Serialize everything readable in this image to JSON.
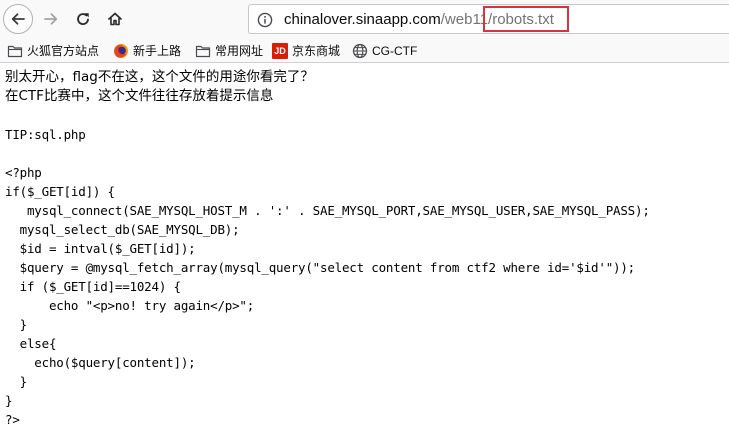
{
  "browser": {
    "url": {
      "domain": "chinalover.sinaapp.com",
      "path_prefix": "/web11",
      "path_highlight": "/robots.txt"
    },
    "icons": [
      "back-arrow-icon",
      "forward-arrow-icon",
      "reload-icon",
      "home-icon",
      "info-icon"
    ],
    "highlight_color": "#d9323a"
  },
  "bookmarks": [
    {
      "label": "火狐官方站点",
      "icon": "folder-icon"
    },
    {
      "label": "新手上路",
      "icon": "firefox-icon"
    },
    {
      "label": "常用网址",
      "icon": "folder-icon"
    },
    {
      "label": "京东商城",
      "icon": "jd-icon",
      "icon_text": "JD"
    },
    {
      "label": "CG-CTF",
      "icon": "globe-icon"
    }
  ],
  "page": {
    "message_lines": [
      "别太开心，flag不在这，这个文件的用途你看完了？",
      "在CTF比赛中，这个文件往往存放着提示信息"
    ],
    "tip": "TIP:sql.php",
    "code_lines": [
      "<?php",
      "if($_GET[id]) {",
      "   mysql_connect(SAE_MYSQL_HOST_M . ':' . SAE_MYSQL_PORT,SAE_MYSQL_USER,SAE_MYSQL_PASS);",
      "  mysql_select_db(SAE_MYSQL_DB);",
      "  $id = intval($_GET[id]);",
      "  $query = @mysql_fetch_array(mysql_query(\"select content from ctf2 where id='$id'\"));",
      "  if ($_GET[id]==1024) {",
      "      echo \"<p>no! try again</p>\";",
      "  }",
      "  else{",
      "    echo($query[content]);",
      "  }",
      "}",
      "?>"
    ]
  }
}
